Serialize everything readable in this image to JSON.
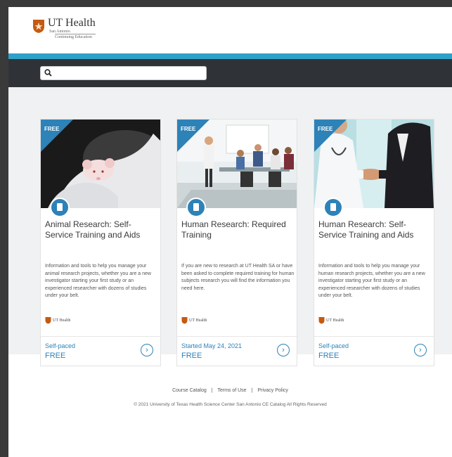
{
  "header": {
    "logo_name": "UT Health",
    "logo_sub1": "San Antonio",
    "logo_sub2": "Continuing Education"
  },
  "search": {
    "placeholder": "",
    "value": ""
  },
  "colors": {
    "accent": "#2fa1c9",
    "primary": "#2d82b7",
    "nav": "#2f3338"
  },
  "courses": [
    {
      "badge": "FREE",
      "title": "Animal Research: Self-Service Training and Aids",
      "description": "Information and tools to help you manage your animal research projects, whether you are a new investigator starting your first study or an experienced researcher with dozens of studies under your belt.",
      "provider_logo": "UT Health",
      "schedule": "Self-paced",
      "price": "FREE",
      "icon": "book-icon"
    },
    {
      "badge": "FREE",
      "title": "Human Research: Required Training",
      "description": "If you are new to research at UT Health SA or have been asked to complete required training for human subjects research you will find the information you need here.",
      "provider_logo": "UT Health",
      "schedule": "Started May 24, 2021",
      "price": "FREE",
      "icon": "book-icon"
    },
    {
      "badge": "FREE",
      "title": "Human Research: Self-Service Training and Aids",
      "description": "Information and tools to help you manage your human research projects, whether you are a new investigator starting your first study or an experienced researcher with dozens of studies under your belt.",
      "provider_logo": "UT Health",
      "schedule": "Self-paced",
      "price": "FREE",
      "icon": "book-icon"
    }
  ],
  "footer": {
    "links": [
      "Course Catalog",
      "Terms of Use",
      "Privacy Policy"
    ],
    "copyright": "© 2021 University of Texas Health Science Center San Antonio CE Catalog All Rights Reserved"
  }
}
